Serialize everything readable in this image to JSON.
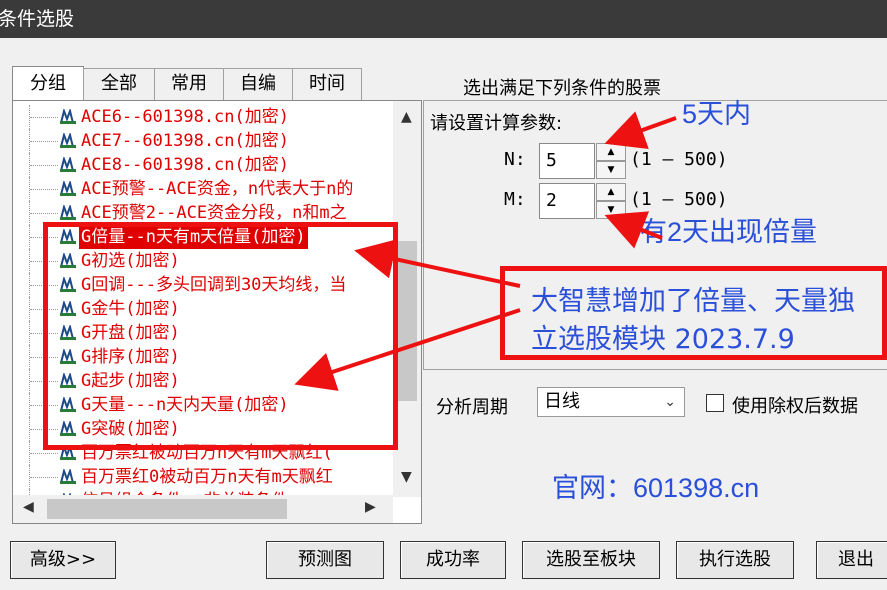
{
  "window": {
    "title": "条件选股"
  },
  "tabs": [
    {
      "label": "分组",
      "active": true
    },
    {
      "label": "全部",
      "active": false
    },
    {
      "label": "常用",
      "active": false
    },
    {
      "label": "自编",
      "active": false
    },
    {
      "label": "时间",
      "active": false
    }
  ],
  "tree": {
    "items": [
      {
        "label": "ACE6--601398.cn(加密)"
      },
      {
        "label": "ACE7--601398.cn(加密)"
      },
      {
        "label": "ACE8--601398.cn(加密)"
      },
      {
        "label": "ACE预警--ACE资金，n代表大于n的"
      },
      {
        "label": "ACE预警2--ACE资金分段，n和m之"
      },
      {
        "label": "G倍量--n天有m天倍量(加密)",
        "selected": true
      },
      {
        "label": "G初选(加密)"
      },
      {
        "label": "G回调---多头回调到30天均线，当"
      },
      {
        "label": "G金牛(加密)"
      },
      {
        "label": "G开盘(加密)"
      },
      {
        "label": "G排序(加密)"
      },
      {
        "label": "G起步(加密)"
      },
      {
        "label": "G天量---n天内天量(加密)"
      },
      {
        "label": "G突破(加密)"
      },
      {
        "label": "百万票红被动百万n天有m天飘红("
      },
      {
        "label": "百万票红0被动百万n天有m天飘红"
      },
      {
        "label": "信号组合条件--非总装条件"
      }
    ]
  },
  "right": {
    "heading": "选出满足下列条件的股票",
    "group_label": "请设置计算参数:",
    "params": [
      {
        "name": "N:",
        "value": "5",
        "range": "(1 — 500)"
      },
      {
        "name": "M:",
        "value": "2",
        "range": "(1 — 500)"
      }
    ],
    "period_label": "分析周期",
    "period_value": "日线",
    "use_adjusted_label": "使用除权后数据"
  },
  "buttons": {
    "advanced": "高级>>",
    "forecast": "预测图",
    "success_rate": "成功率",
    "to_block": "选股至板块",
    "execute": "执行选股",
    "exit": "退出"
  },
  "annotations": {
    "five_days": "5天内",
    "two_days": "有2天出现倍量",
    "box_line1": "大智慧增加了倍量、天量独",
    "box_line2": "立选股模块 2023.7.9",
    "website": "官网：601398.cn",
    "color": "#2a4fd8",
    "box_color": "#ee1111"
  }
}
